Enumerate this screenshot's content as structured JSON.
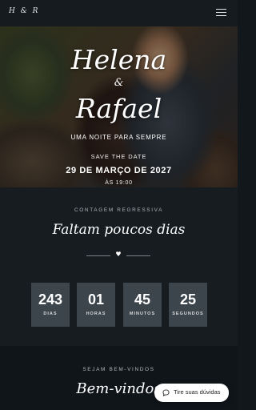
{
  "nav": {
    "logo": "H & R",
    "menu_icon": "hamburger-menu-icon"
  },
  "hero": {
    "name1": "Helena",
    "amp": "&",
    "name2": "Rafael",
    "tagline": "UMA NOITE PARA SEMPRE",
    "save_the_date": "SAVE THE DATE",
    "date": "29 DE MARÇO DE 2027",
    "time": "ÀS 19:00"
  },
  "countdown": {
    "eyebrow": "CONTAGEM REGRESSIVA",
    "title": "Faltam poucos dias",
    "divider_icon": "heart-icon",
    "units": [
      {
        "value": "243",
        "label": "DIAS"
      },
      {
        "value": "01",
        "label": "HORAS"
      },
      {
        "value": "45",
        "label": "MINUTOS"
      },
      {
        "value": "25",
        "label": "SEGUNDOS"
      }
    ]
  },
  "welcome": {
    "eyebrow": "SEJAM BEM-VINDOS",
    "title": "Bem-vindos"
  },
  "help": {
    "label": "Tire suas dúvidas",
    "icon": "chat-bubble-icon"
  }
}
